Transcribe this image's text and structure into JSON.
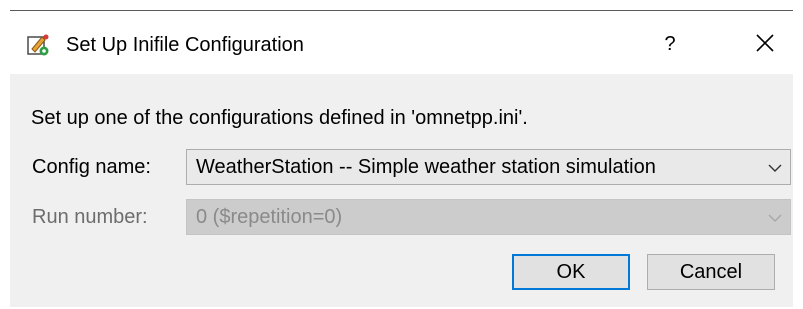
{
  "window": {
    "title": "Set Up Inifile Configuration",
    "app_icon": "omnetpp-config-icon",
    "help_label": "?",
    "close_icon": "close-icon"
  },
  "description": "Set up one of the configurations defined in 'omnetpp.ini'.",
  "config": {
    "label": "Config name:",
    "value": "WeatherStation -- Simple weather station simulation"
  },
  "run": {
    "label": "Run number:",
    "value": "0 ($repetition=0)",
    "enabled": false
  },
  "buttons": {
    "ok_label": "OK",
    "cancel_label": "Cancel"
  },
  "colors": {
    "accent": "#0078d7",
    "dialog_bg": "#f0f0f0",
    "disabled_text": "#8a8a8a"
  }
}
